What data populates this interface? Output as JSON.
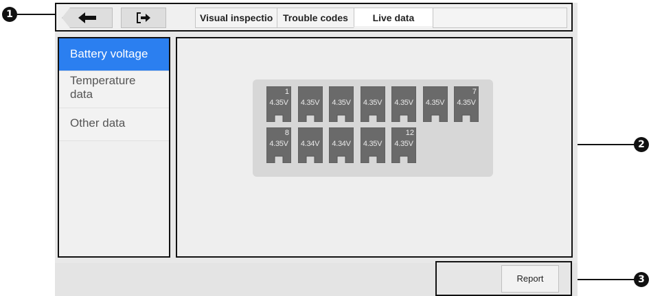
{
  "callouts": {
    "top": "1",
    "middle": "2",
    "bottom": "3"
  },
  "toolbar": {
    "back_icon": "back-arrow-icon",
    "exit_icon": "exit-icon",
    "tabs": [
      {
        "label": "Visual inspectio"
      },
      {
        "label": "Trouble codes"
      },
      {
        "label": "Live data"
      }
    ],
    "active_tab": "Live data"
  },
  "sidebar": {
    "items": [
      {
        "label": "Battery voltage",
        "selected": true
      },
      {
        "label": "Temperature data",
        "selected": false
      },
      {
        "label": "Other data",
        "selected": false
      }
    ]
  },
  "cells": {
    "row1": [
      {
        "number": "1",
        "voltage": "4.35V"
      },
      {
        "number": "",
        "voltage": "4.35V"
      },
      {
        "number": "",
        "voltage": "4.35V"
      },
      {
        "number": "",
        "voltage": "4.35V"
      },
      {
        "number": "",
        "voltage": "4.35V"
      },
      {
        "number": "",
        "voltage": "4.35V"
      },
      {
        "number": "7",
        "voltage": "4.35V"
      }
    ],
    "row2": [
      {
        "number": "8",
        "voltage": "4.35V"
      },
      {
        "number": "",
        "voltage": "4.34V"
      },
      {
        "number": "",
        "voltage": "4.34V"
      },
      {
        "number": "",
        "voltage": "4.35V"
      },
      {
        "number": "12",
        "voltage": "4.35V"
      }
    ]
  },
  "footer": {
    "report_label": "Report"
  },
  "colors": {
    "accent": "#2b7ff0",
    "cell": "#6a6a6a"
  }
}
